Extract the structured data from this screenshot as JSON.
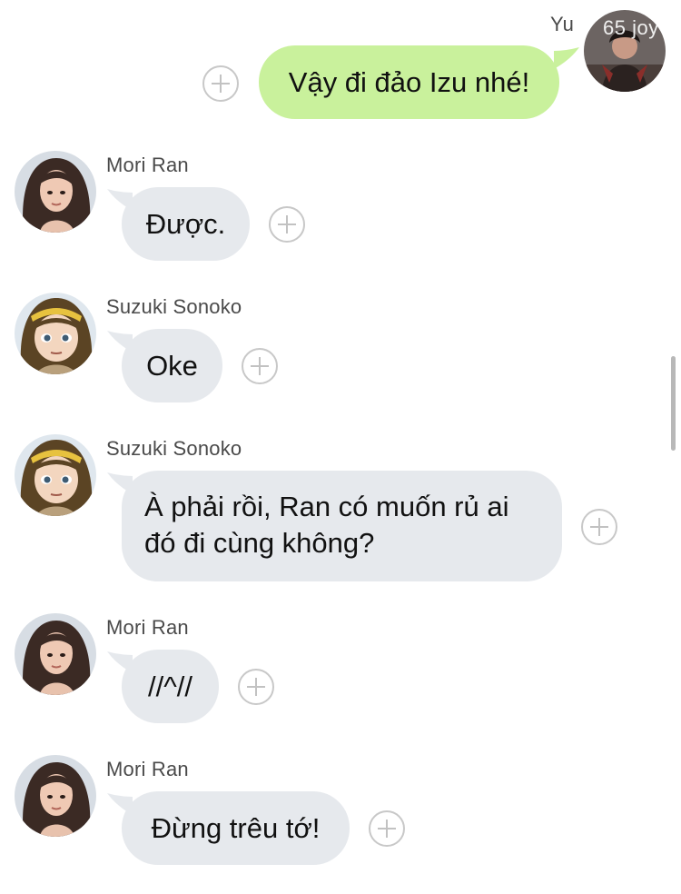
{
  "chat": {
    "outgoing": {
      "sender": "Yu",
      "text": "Vậy đi đảo Izu nhé!",
      "avatar_watermark": "65 joy"
    },
    "messages": [
      {
        "sender": "Mori Ran",
        "text": "Được."
      },
      {
        "sender": "Suzuki Sonoko",
        "text": "Oke"
      },
      {
        "sender": "Suzuki Sonoko",
        "text_line1": "À phải rồi, Ran có muốn rủ ai",
        "text_line2": "đó đi cùng không?"
      },
      {
        "sender": "Mori Ran",
        "text": "//^//"
      },
      {
        "sender": "Mori Ran",
        "text": "Đừng trêu tớ!"
      }
    ]
  },
  "colors": {
    "incoming_bubble": "#e6e9ed",
    "outgoing_bubble": "#c9f19c",
    "background": "#ffffff"
  },
  "icons": {
    "add_reaction": "plus-circle-icon"
  }
}
